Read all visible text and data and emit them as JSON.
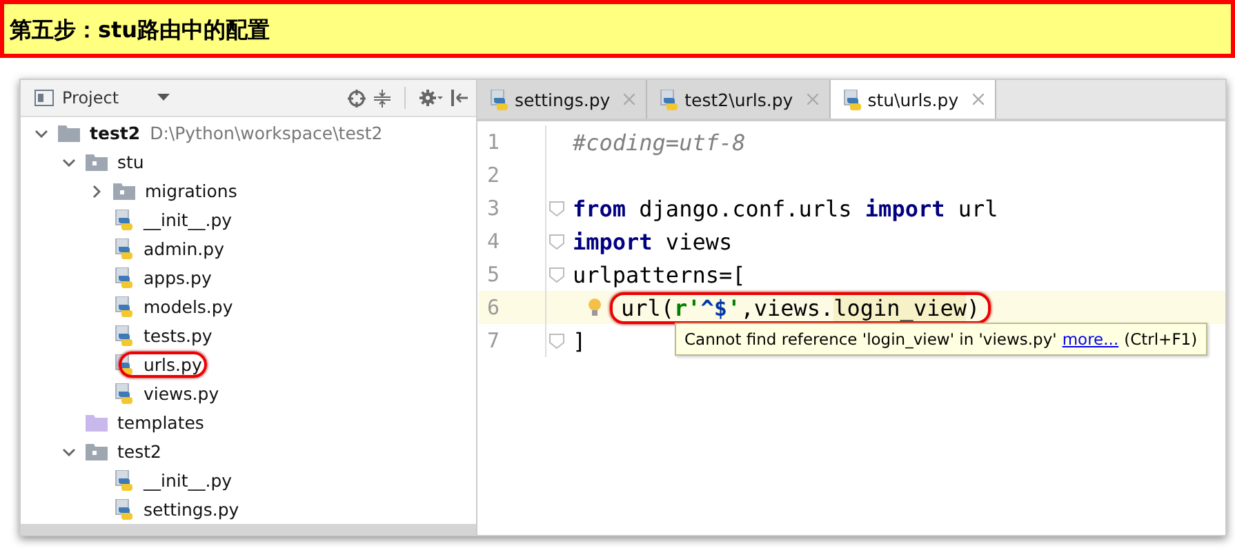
{
  "banner": {
    "title": "第五步：stu路由中的配置"
  },
  "project_panel": {
    "title": "Project",
    "tree": [
      {
        "kind": "folder",
        "name": "test2",
        "path": "D:\\Python\\workspace\\test2",
        "expanded": true,
        "children": [
          {
            "kind": "package",
            "name": "stu",
            "expanded": true,
            "children": [
              {
                "kind": "package",
                "name": "migrations",
                "expanded": false
              },
              {
                "kind": "python",
                "name": "__init__.py",
                "circled": false
              },
              {
                "kind": "python",
                "name": "admin.py",
                "circled": false
              },
              {
                "kind": "python",
                "name": "apps.py",
                "circled": false
              },
              {
                "kind": "python",
                "name": "models.py",
                "circled": false
              },
              {
                "kind": "python",
                "name": "tests.py",
                "circled": false
              },
              {
                "kind": "python",
                "name": "urls.py",
                "circled": true
              },
              {
                "kind": "python",
                "name": "views.py",
                "circled": false
              }
            ]
          },
          {
            "kind": "templates",
            "name": "templates"
          },
          {
            "kind": "package",
            "name": "test2",
            "expanded": true,
            "children": [
              {
                "kind": "python",
                "name": "__init__.py",
                "circled": false
              },
              {
                "kind": "python",
                "name": "settings.py",
                "circled": false
              }
            ]
          }
        ]
      }
    ]
  },
  "editor": {
    "tabs": [
      {
        "label": "settings.py",
        "selected": false
      },
      {
        "label": "test2\\urls.py",
        "selected": false
      },
      {
        "label": "stu\\urls.py",
        "selected": true
      }
    ],
    "lines": [
      {
        "number": "1",
        "current": false,
        "circled": false,
        "tokens": [
          {
            "kind": "comment",
            "text": "#coding=utf-8"
          }
        ]
      },
      {
        "number": "2",
        "current": false
      },
      {
        "number": "3",
        "current": false,
        "circled": false,
        "fold": true,
        "tokens": [
          {
            "kind": "keyword",
            "text": "from"
          },
          {
            "kind": "plain",
            "text": " django.conf.urls "
          },
          {
            "kind": "keyword",
            "text": "import"
          },
          {
            "kind": "plain",
            "text": " url"
          }
        ]
      },
      {
        "number": "4",
        "current": false,
        "circled": false,
        "fold": true,
        "tokens": [
          {
            "kind": "keyword",
            "text": "import"
          },
          {
            "kind": "plain",
            "text": " views"
          }
        ]
      },
      {
        "number": "5",
        "current": false,
        "circled": false,
        "fold": true,
        "tokens": [
          {
            "kind": "plain",
            "text": "urlpatterns=["
          }
        ]
      },
      {
        "number": "6",
        "current": true,
        "circled": true,
        "bulb": true,
        "tokens": [
          {
            "kind": "plain",
            "text": "url("
          },
          {
            "kind": "string",
            "text": "r'"
          },
          {
            "kind": "regex",
            "text": "^$"
          },
          {
            "kind": "string",
            "text": "'"
          },
          {
            "kind": "plain",
            "text": ",views."
          },
          {
            "kind": "unresolved",
            "text": "login_view"
          },
          {
            "kind": "plain",
            "text": ")"
          }
        ]
      },
      {
        "number": "7",
        "current": false,
        "circled": false,
        "fold": true,
        "tokens": [
          {
            "kind": "plain",
            "text": "]"
          }
        ]
      }
    ],
    "tooltip": {
      "message": "Cannot find reference 'login_view' in 'views.py'",
      "link": "more...",
      "shortcut": "(Ctrl+F1)"
    }
  }
}
